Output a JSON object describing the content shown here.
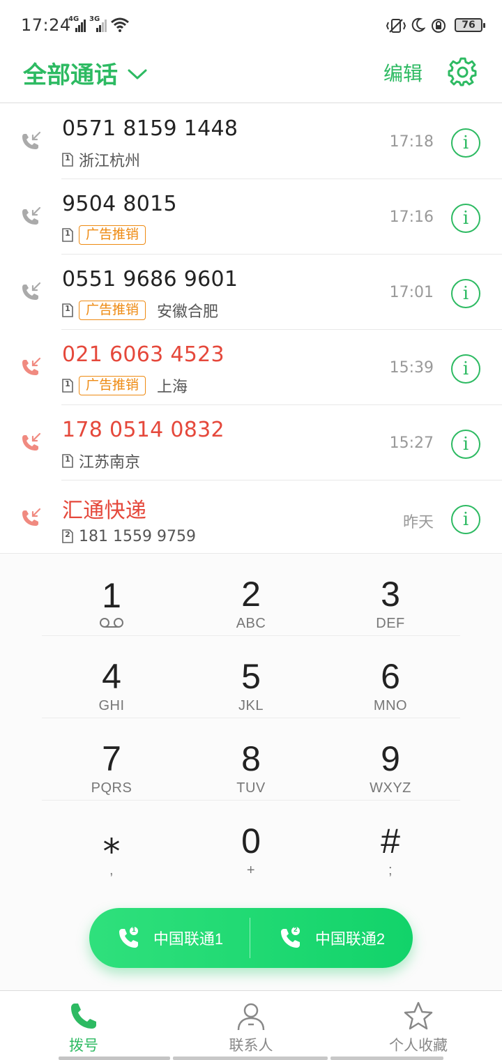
{
  "status_bar": {
    "time": "17:24",
    "signal1_tag": "4G",
    "signal2_tag": "3G",
    "battery": "76"
  },
  "header": {
    "title": "全部通话",
    "edit_label": "编辑"
  },
  "calls": [
    {
      "name": "0571 8159 1448",
      "sim": "1",
      "tag": "",
      "location": "浙江杭州",
      "time": "17:18",
      "missed": false
    },
    {
      "name": "9504 8015",
      "sim": "1",
      "tag": "广告推销",
      "location": "",
      "time": "17:16",
      "missed": false
    },
    {
      "name": "0551 9686 9601",
      "sim": "1",
      "tag": "广告推销",
      "location": "安徽合肥",
      "time": "17:01",
      "missed": false
    },
    {
      "name": "021 6063 4523",
      "sim": "1",
      "tag": "广告推销",
      "location": "上海",
      "time": "15:39",
      "missed": true
    },
    {
      "name": "178 0514 0832",
      "sim": "1",
      "tag": "",
      "location": "江苏南京",
      "time": "15:27",
      "missed": true
    },
    {
      "name": "汇通快递",
      "sim": "2",
      "tag": "",
      "location": "181 1559 9759",
      "time": "昨天",
      "missed": true
    }
  ],
  "dialpad": {
    "keys": [
      {
        "digit": "1",
        "letters": ""
      },
      {
        "digit": "2",
        "letters": "ABC"
      },
      {
        "digit": "3",
        "letters": "DEF"
      },
      {
        "digit": "4",
        "letters": "GHI"
      },
      {
        "digit": "5",
        "letters": "JKL"
      },
      {
        "digit": "6",
        "letters": "MNO"
      },
      {
        "digit": "7",
        "letters": "PQRS"
      },
      {
        "digit": "8",
        "letters": "TUV"
      },
      {
        "digit": "9",
        "letters": "WXYZ"
      },
      {
        "digit": "⁎",
        "letters": ","
      },
      {
        "digit": "0",
        "letters": "+"
      },
      {
        "digit": "#",
        "letters": ";"
      }
    ]
  },
  "call_buttons": {
    "sim1_label": "中国联通1",
    "sim1_badge": "1",
    "sim2_label": "中国联通2",
    "sim2_badge": "2"
  },
  "bottom_nav": {
    "items": [
      {
        "label": "拨号",
        "icon": "phone-icon",
        "active": true
      },
      {
        "label": "联系人",
        "icon": "person-icon",
        "active": false
      },
      {
        "label": "个人收藏",
        "icon": "star-icon",
        "active": false
      }
    ]
  },
  "colors": {
    "accent": "#2dba62",
    "missed": "#e5483b",
    "ad_tag": "#ee8a12"
  }
}
